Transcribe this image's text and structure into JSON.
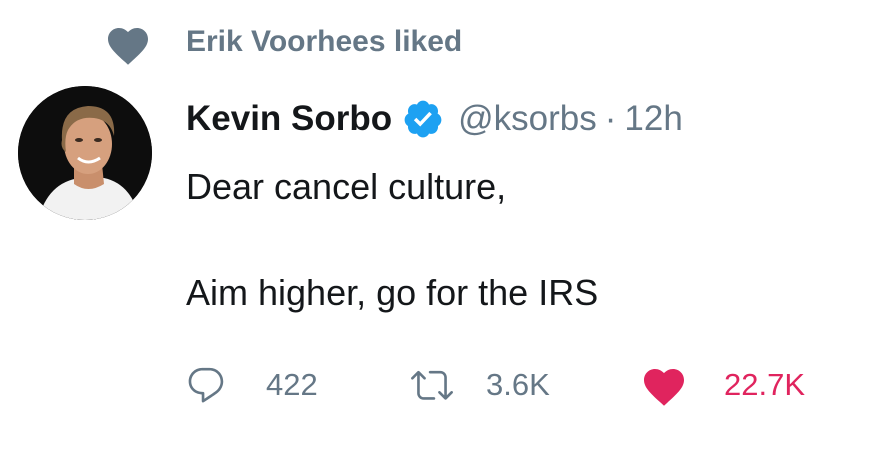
{
  "colors": {
    "text_primary": "#14171a",
    "text_secondary": "#657786",
    "like_active": "#e0245e",
    "verified_blue": "#1da1f2",
    "context_heart": "#657786"
  },
  "context": {
    "icon": "heart-icon",
    "text": "Erik Voorhees liked"
  },
  "tweet": {
    "author": {
      "display_name": "Kevin Sorbo",
      "verified": true,
      "handle": "@ksorbs",
      "separator": "·",
      "time": "12h"
    },
    "text_lines": [
      "Dear cancel culture,",
      "Aim higher, go for the IRS"
    ]
  },
  "actions": {
    "reply": {
      "icon": "reply-icon",
      "count": "422"
    },
    "retweet": {
      "icon": "retweet-icon",
      "count": "3.6K"
    },
    "like": {
      "icon": "heart-icon",
      "count": "22.7K",
      "active": true
    }
  }
}
